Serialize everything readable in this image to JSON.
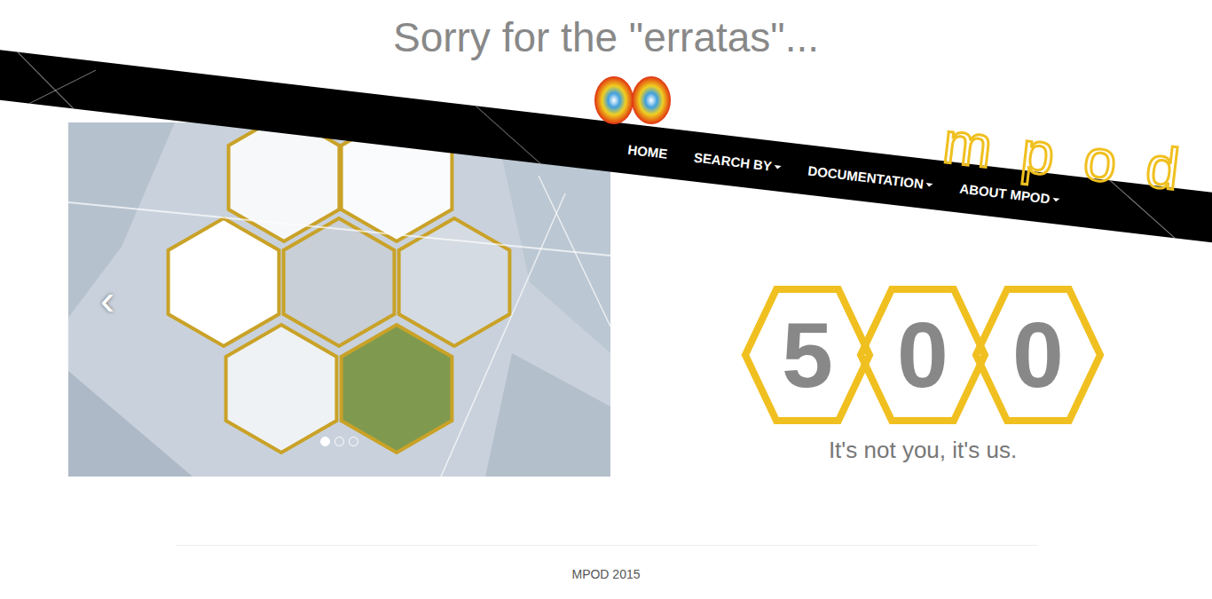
{
  "page": {
    "title": "Sorry for the \"erratas\"..."
  },
  "nav": {
    "brand": "mpod",
    "items": [
      {
        "label": "HOME",
        "dropdown": false
      },
      {
        "label": "SEARCH BY",
        "dropdown": true
      },
      {
        "label": "DOCUMENTATION",
        "dropdown": true
      },
      {
        "label": "ABOUT MPOD",
        "dropdown": true
      }
    ]
  },
  "carousel": {
    "prev": "‹",
    "slides": [
      {
        "selected": true
      },
      {
        "selected": false
      },
      {
        "selected": false
      }
    ]
  },
  "error": {
    "digits": [
      "5",
      "0",
      "0"
    ],
    "message": "It's not you, it's us."
  },
  "footer": {
    "text": "MPOD 2015"
  }
}
